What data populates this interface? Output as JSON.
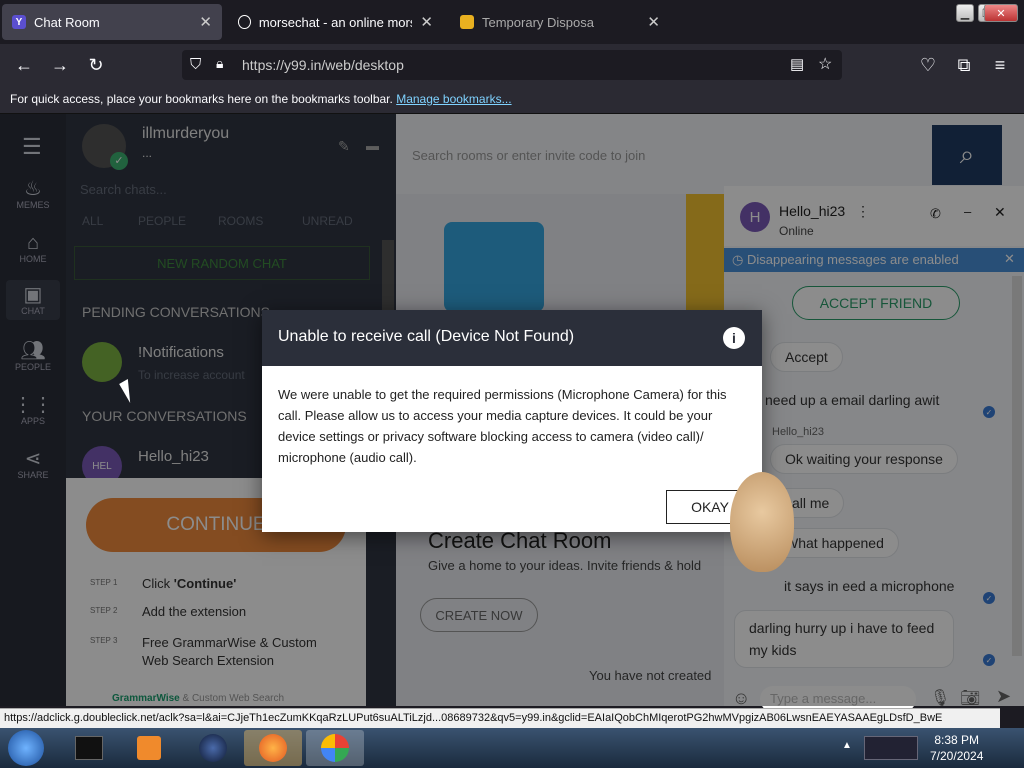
{
  "browser": {
    "tabs": [
      {
        "label": "Chat Room",
        "favicon": "Y",
        "active": true
      },
      {
        "label": "morsechat - an online morse co",
        "active": false
      },
      {
        "label": "Temporary Disposa",
        "active": false
      }
    ],
    "url": "https://y99.in/web/desktop",
    "bookmarks_text": "For quick access, place your bookmarks here on the bookmarks toolbar.",
    "bookmarks_link": "Manage bookmarks..."
  },
  "sidebar": {
    "items": [
      {
        "label": "MEMES"
      },
      {
        "label": "HOME"
      },
      {
        "label": "CHAT"
      },
      {
        "label": "PEOPLE"
      },
      {
        "label": "APPS"
      },
      {
        "label": "SHARE"
      }
    ]
  },
  "chatlist": {
    "username": "illmurderyou",
    "status": "...",
    "search_placeholder": "Search chats...",
    "filters": [
      "ALL",
      "PEOPLE",
      "ROOMS",
      "UNREAD"
    ],
    "new_random": "NEW RANDOM CHAT",
    "pending_header": "PENDING CONVERSATIONS",
    "notif_title": "!Notifications",
    "notif_sub": "To increase account",
    "your_header": "YOUR CONVERSATIONS",
    "convo_name": "Hello_hi23",
    "convo_avatar": "HEL"
  },
  "ad": {
    "continue": "CONTINUE",
    "steps": [
      {
        "num": "STEP 1",
        "pre": "Click ",
        "bold": "'Continue'"
      },
      {
        "num": "STEP 2",
        "text": "Add the extension"
      },
      {
        "num": "STEP 3",
        "text": "Free GrammarWise & Custom Web Search Extension"
      }
    ],
    "footer_brand": "GrammarWise",
    "footer_rest": " & Custom Web Search"
  },
  "main": {
    "search_placeholder": "Search rooms or enter invite code to join",
    "create_title": "Create Chat Room",
    "create_sub": "Give a home to your ideas. Invite friends & hold",
    "create_btn": "CREATE NOW",
    "not_created": "You have not created"
  },
  "chatpop": {
    "name": "Hello_hi23",
    "avatar": "H",
    "status": "Online",
    "banner": "Disappearing messages are enabled",
    "accept_friend": "ACCEPT FRIEND",
    "messages": [
      {
        "text": "Accept"
      },
      {
        "text": "i need up a email darling awit"
      },
      {
        "sender": "Hello_hi23"
      },
      {
        "text": "Ok waiting your response"
      },
      {
        "text": "call me"
      },
      {
        "text": "What happened"
      },
      {
        "text": "it says in eed a microphone"
      },
      {
        "text": "darling hurry up i have to feed my kids"
      }
    ],
    "input_placeholder": "Type a message..."
  },
  "modal": {
    "title": "Unable to receive call (Device Not Found)",
    "body": "We were unable to get the required permissions (Microphone Camera) for this call. Please allow us to access your media capture devices. It could be your device settings or privacy software blocking access to camera (video call)/ microphone (audio call).",
    "ok": "OKAY"
  },
  "status_url": "https://adclick.g.doubleclick.net/aclk?sa=l&ai=CJjeTh1ecZumKKqaRzLUPut6suALTiLzjd...08689732&qv5=y99.in&gclid=EAIaIQobChMIqerotPG2hwMVpgizAB06LwsnEAEYASAAEgLDsfD_BwE",
  "taskbar": {
    "time": "8:38 PM",
    "date": "7/20/2024"
  }
}
